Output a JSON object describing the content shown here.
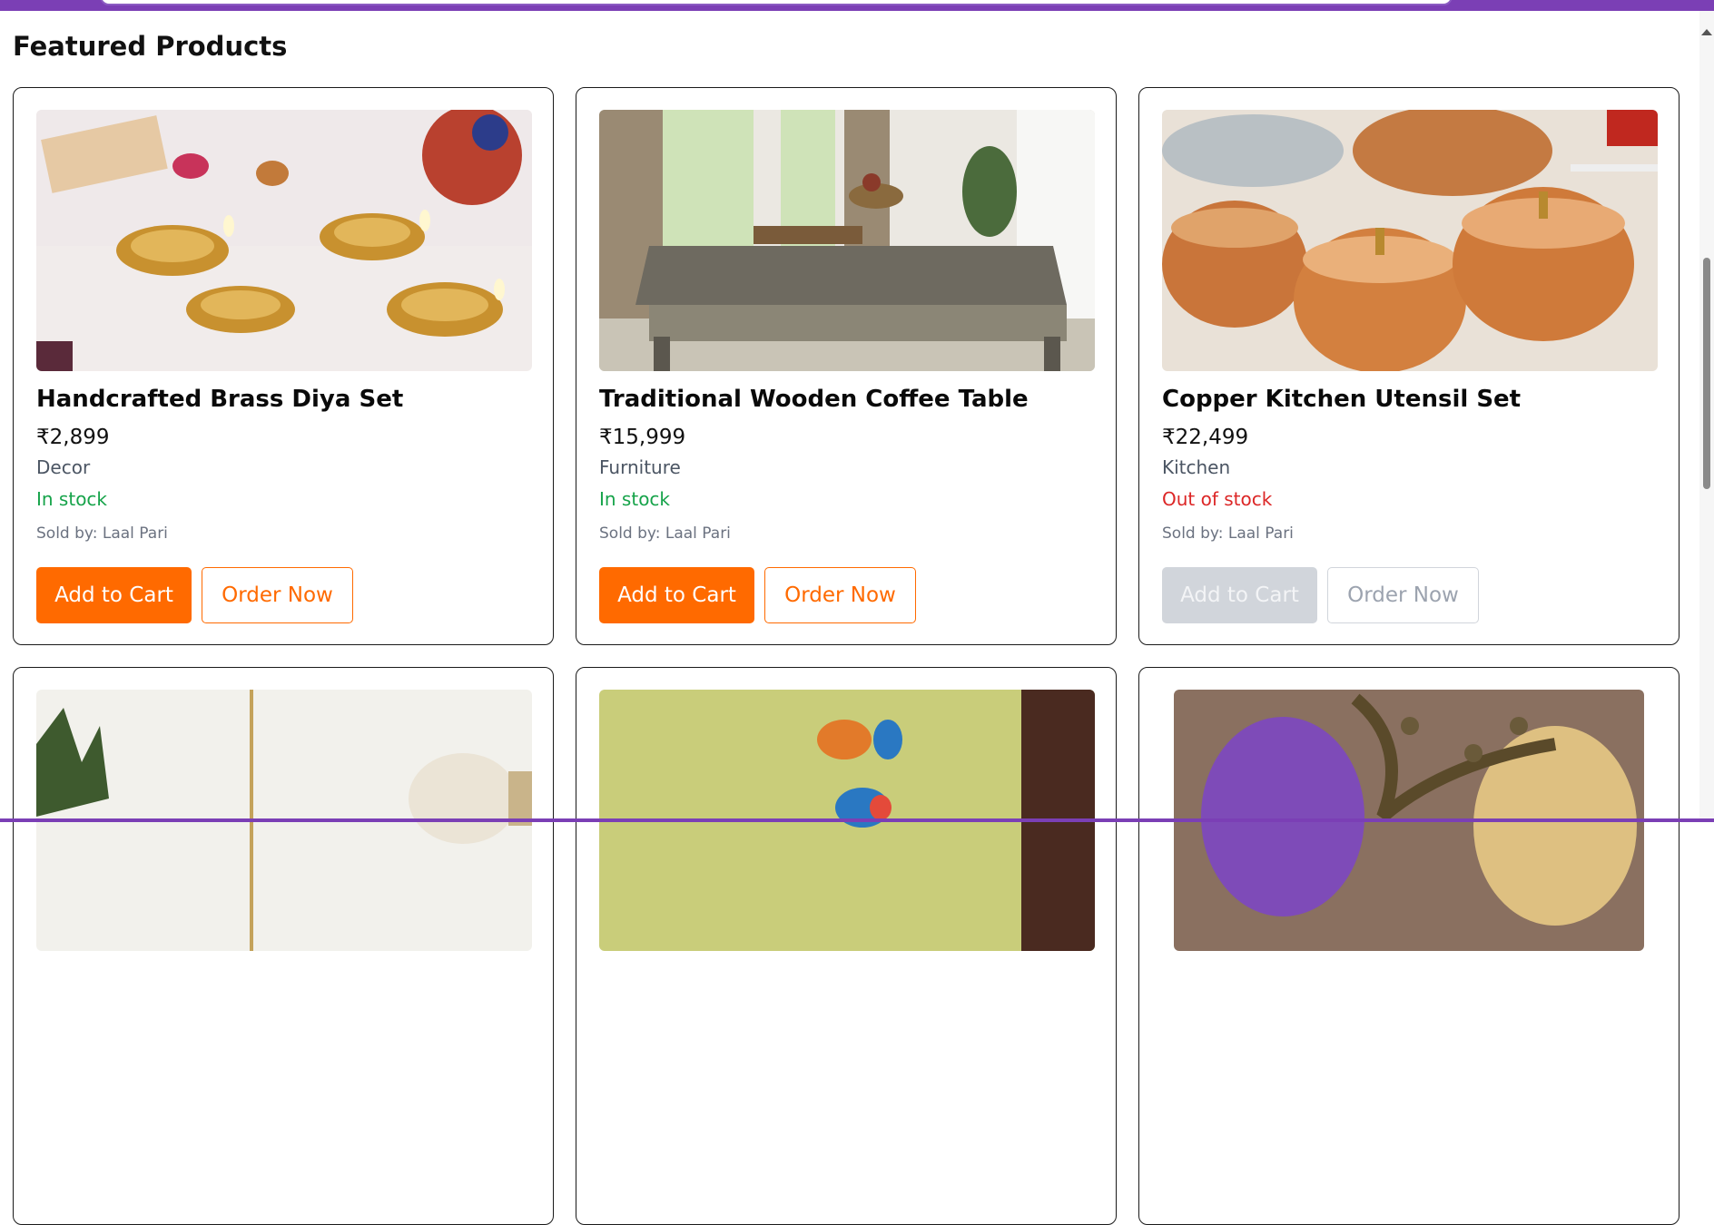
{
  "section": {
    "title": "Featured Products"
  },
  "products": [
    {
      "name": "Handcrafted Brass Diya Set",
      "price": "₹2,899",
      "category": "Decor",
      "stock": "In stock",
      "seller": "Sold by: Laal Pari",
      "add_label": "Add to Cart",
      "order_label": "Order Now"
    },
    {
      "name": "Traditional Wooden Coffee Table",
      "price": "₹15,999",
      "category": "Furniture",
      "stock": "In stock",
      "seller": "Sold by: Laal Pari",
      "add_label": "Add to Cart",
      "order_label": "Order Now"
    },
    {
      "name": "Copper Kitchen Utensil Set",
      "price": "₹22,499",
      "category": "Kitchen",
      "stock": "Out of stock",
      "seller": "Sold by: Laal Pari",
      "add_label": "Add to Cart",
      "order_label": "Order Now"
    }
  ],
  "colors": {
    "header": "#7b3fb5",
    "accent": "#ff6a00",
    "in_stock": "#16a34a",
    "out_of_stock": "#dc2626"
  }
}
